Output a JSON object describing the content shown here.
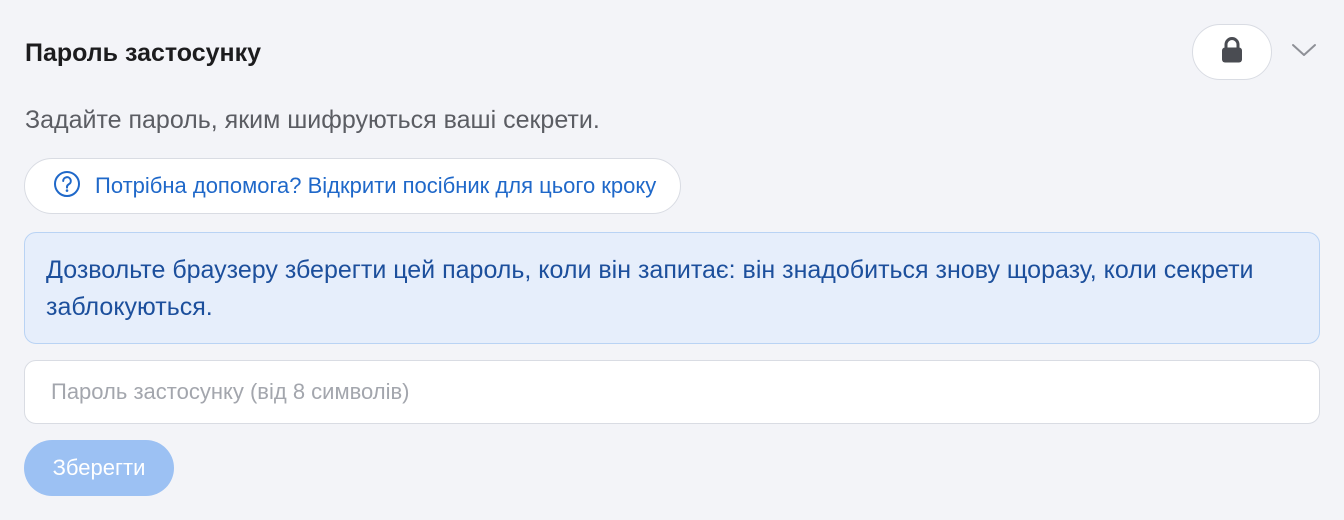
{
  "panel": {
    "title": "Пароль застосунку",
    "description": "Задайте пароль, яким шифруються ваші секрети.",
    "help_link_label": "Потрібна допомога? Відкрити посібник для цього кроку",
    "info_message": "Дозвольте браузеру зберегти цей пароль, коли він запитає: він знадобиться знову щоразу, коли секрети заблокуються.",
    "password_input": {
      "value": "",
      "placeholder": "Пароль застосунку (від 8 символів)"
    },
    "save_label": "Зберегти"
  },
  "icons": {
    "lock": "lock-icon",
    "chevron": "chevron-down-icon",
    "help": "help-circle-icon"
  },
  "colors": {
    "accent": "#1f68c9",
    "info_text": "#1c4f9c",
    "info_background": "#e6eefb",
    "save_button_disabled": "#9cc1f3"
  }
}
